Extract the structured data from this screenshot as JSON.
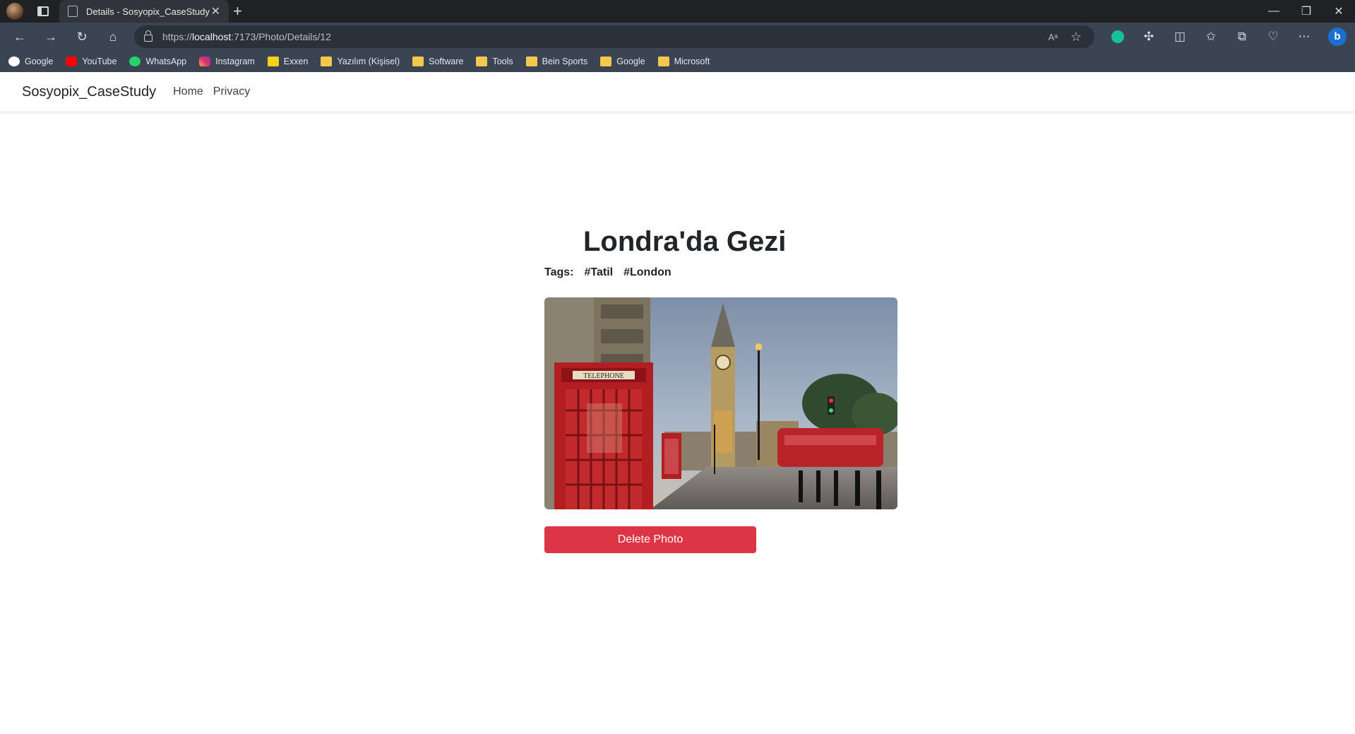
{
  "browser": {
    "tab_title": "Details - Sosyopix_CaseStudy",
    "url_prefix": "https://",
    "url_host": "localhost",
    "url_rest": ":7173/Photo/Details/12",
    "bookmarks": [
      {
        "label": "Google",
        "icon": "google-icon"
      },
      {
        "label": "YouTube",
        "icon": "youtube-icon"
      },
      {
        "label": "WhatsApp",
        "icon": "whatsapp-icon"
      },
      {
        "label": "Instagram",
        "icon": "instagram-icon"
      },
      {
        "label": "Exxen",
        "icon": "exxen-icon"
      },
      {
        "label": "Yazılım (Kişisel)",
        "icon": "folder-icon"
      },
      {
        "label": "Software",
        "icon": "folder-icon"
      },
      {
        "label": "Tools",
        "icon": "folder-icon"
      },
      {
        "label": "Bein Sports",
        "icon": "folder-icon"
      },
      {
        "label": "Google",
        "icon": "folder-icon"
      },
      {
        "label": "Microsoft",
        "icon": "folder-icon"
      }
    ]
  },
  "site": {
    "brand": "Sosyopix_CaseStudy",
    "nav": {
      "home": "Home",
      "privacy": "Privacy"
    }
  },
  "photo": {
    "title": "Londra'da Gezi",
    "tags_label": "Tags:",
    "tags": [
      "#Tatil",
      "#London"
    ],
    "delete_label": "Delete Photo"
  },
  "colors": {
    "danger": "#dc3545",
    "chrome_bg": "#3a4452",
    "tabbar_bg": "#202124"
  }
}
